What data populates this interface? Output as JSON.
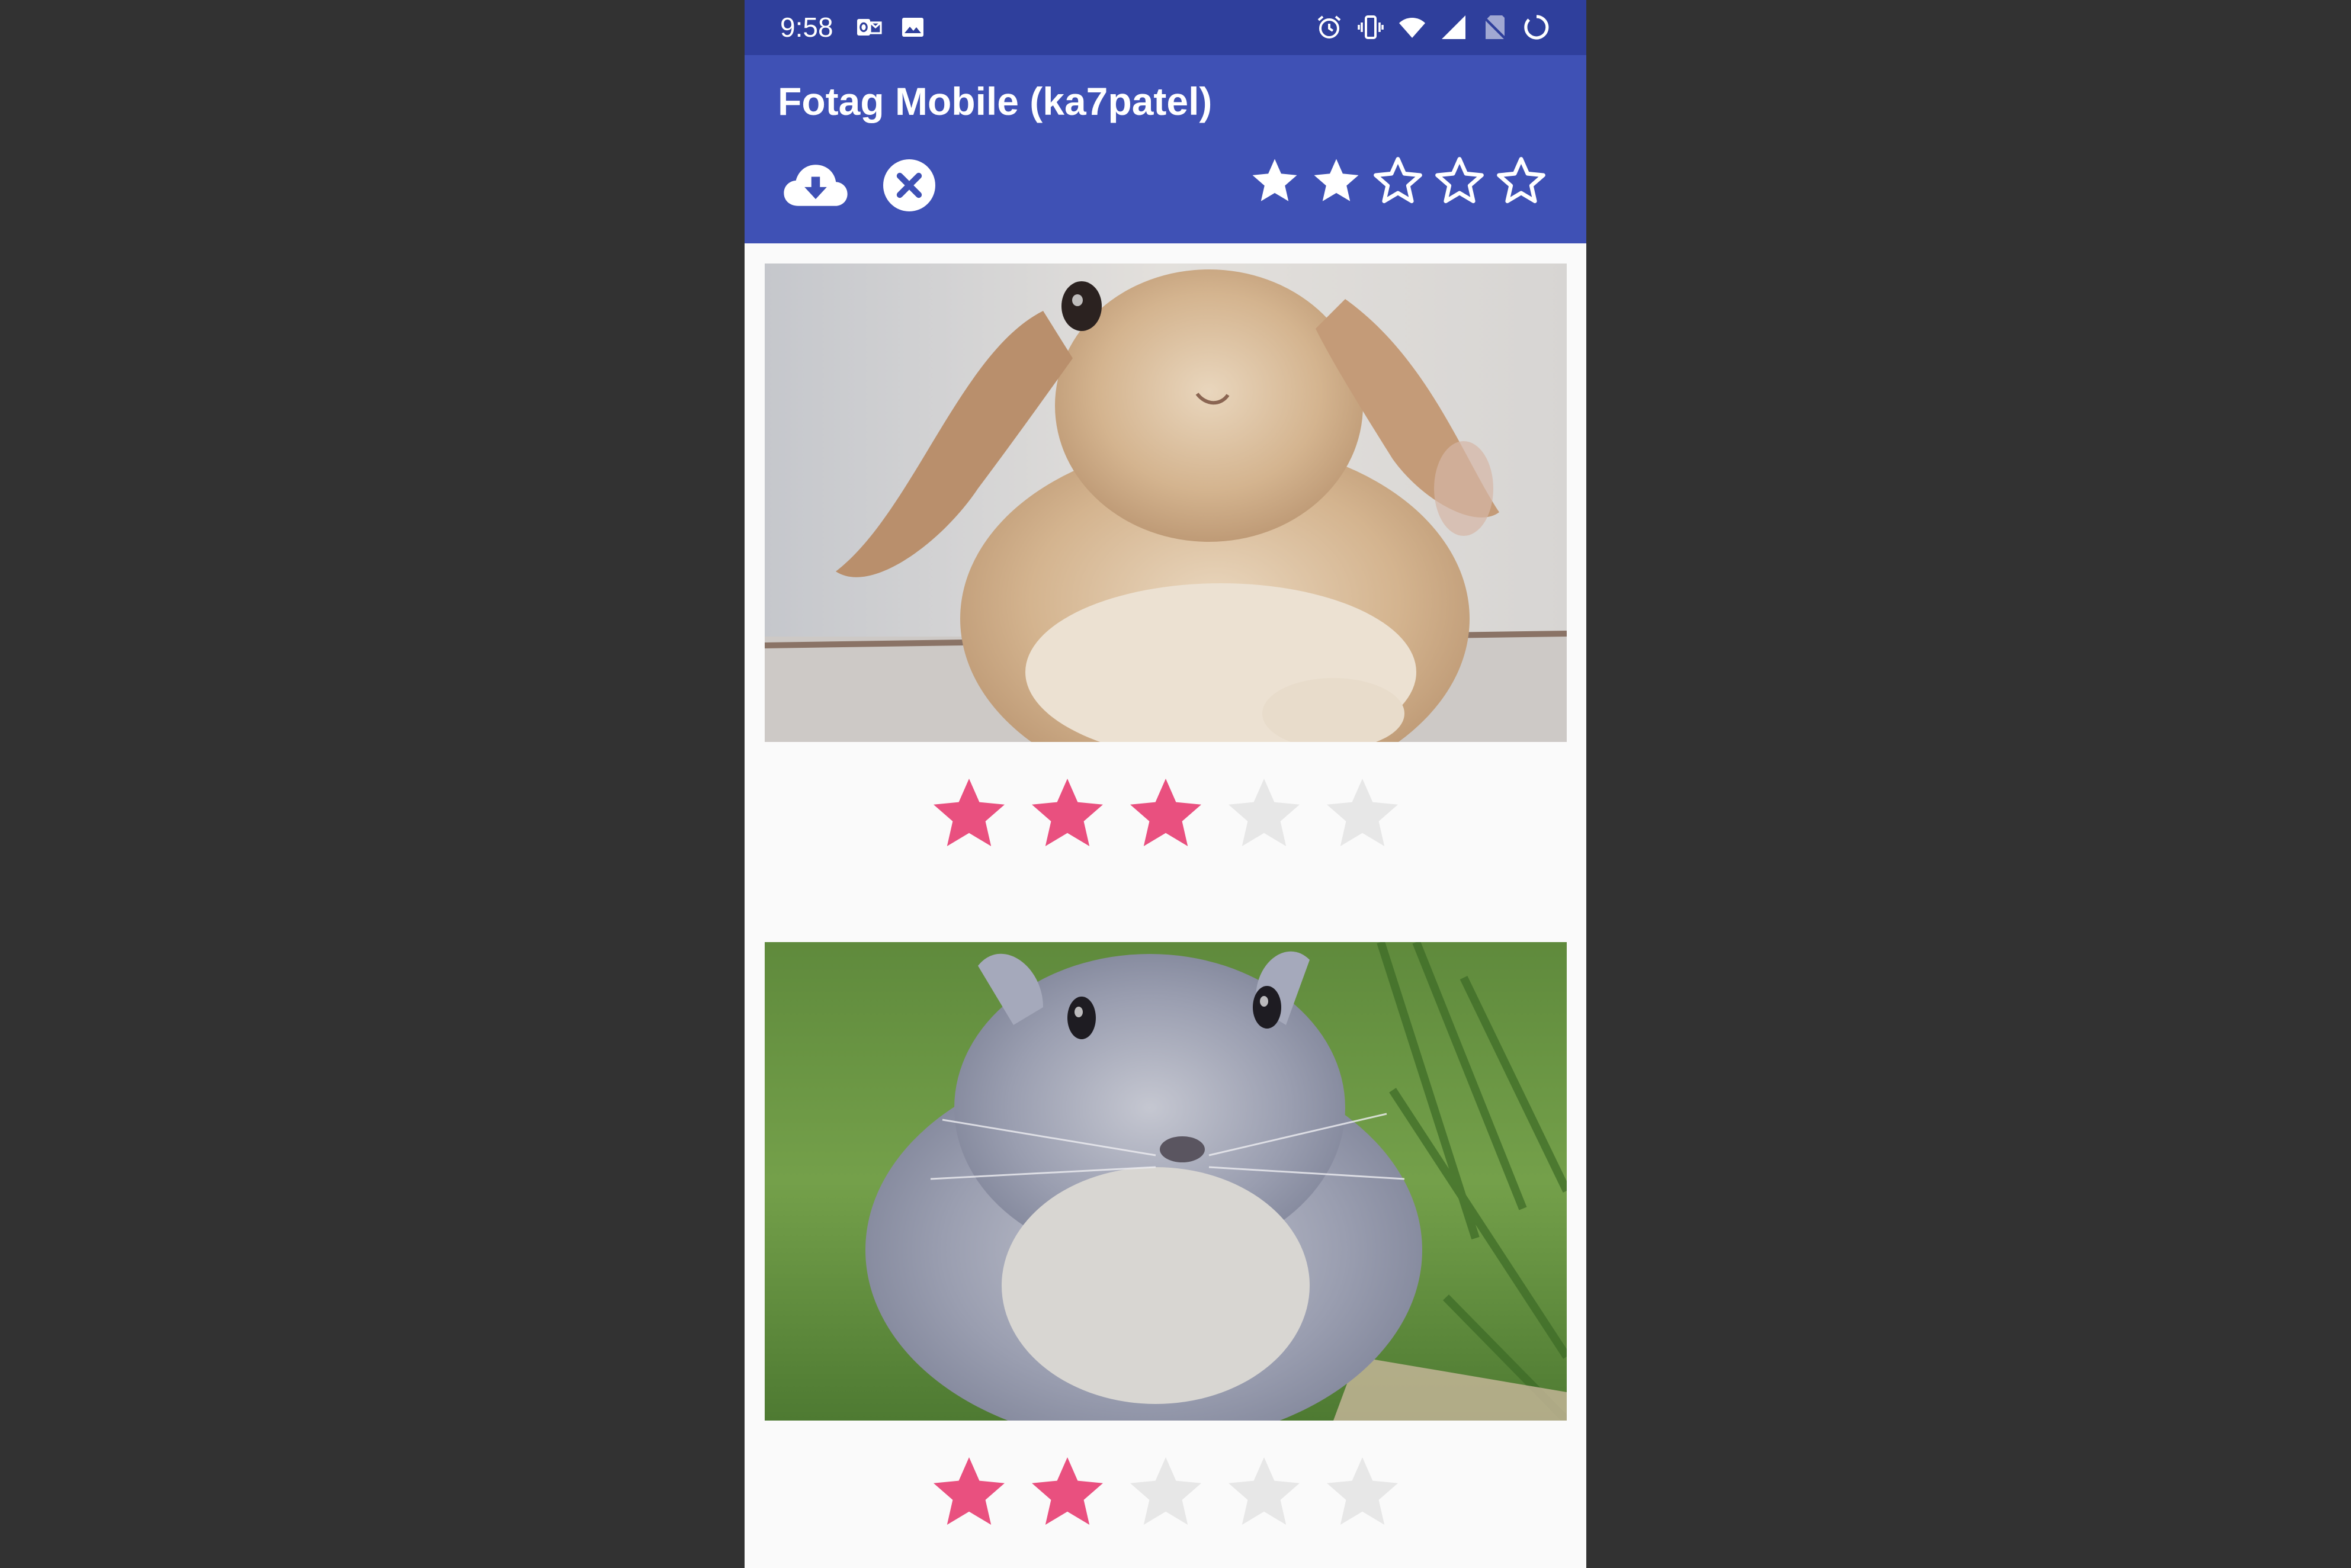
{
  "status_bar": {
    "time": "9:58",
    "left_icons": [
      "outlook-icon",
      "image-icon"
    ],
    "right_icons": [
      "alarm-icon",
      "vibrate-icon",
      "wifi-icon",
      "signal-icon",
      "no-sim-icon",
      "battery-saver-icon"
    ]
  },
  "app_bar": {
    "title": "Fotag Mobile (ka7patel)",
    "actions": [
      {
        "name": "cloud-download-icon"
      },
      {
        "name": "clear-filter-icon"
      }
    ],
    "filter_rating": {
      "value": 2,
      "max": 5
    }
  },
  "gallery": {
    "images": [
      {
        "subject": "bunny-tan",
        "rating": 3,
        "max": 5
      },
      {
        "subject": "bunny-gray",
        "rating": 2,
        "max": 5
      }
    ]
  },
  "colors": {
    "status_bar": "#2f3f9c",
    "app_bar": "#3f51b5",
    "star_active": "#e9507f",
    "star_inactive": "#e7e7e7",
    "background": "#fafafa"
  }
}
